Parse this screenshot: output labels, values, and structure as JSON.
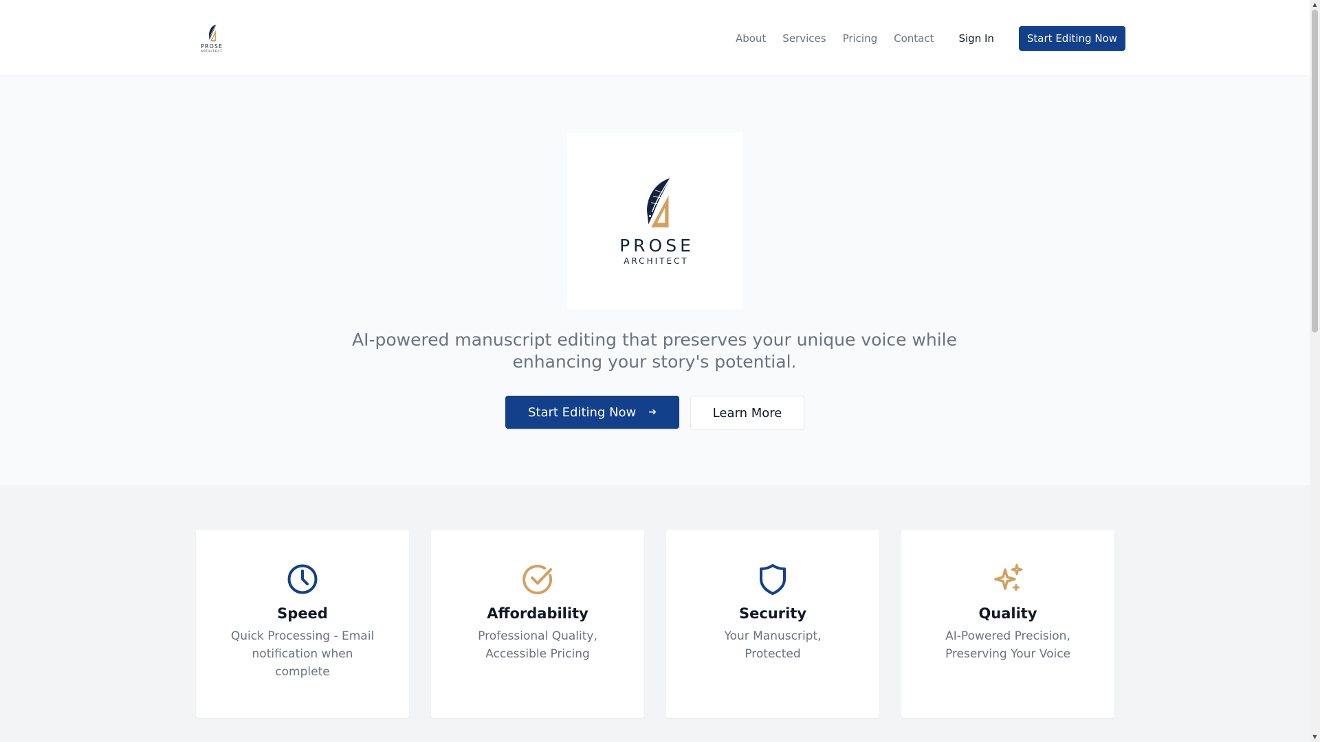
{
  "header": {
    "logo": {
      "wordmark": "PROSE",
      "subtitle": "ARCHITECT"
    },
    "nav": [
      {
        "label": "About"
      },
      {
        "label": "Services"
      },
      {
        "label": "Pricing"
      },
      {
        "label": "Contact"
      }
    ],
    "sign_in_label": "Sign In",
    "cta_label": "Start Editing Now"
  },
  "hero": {
    "logo": {
      "wordmark": "PROSE",
      "subtitle": "ARCHITECT"
    },
    "tagline": "AI-powered manuscript editing that preserves your unique voice while enhancing your story's potential.",
    "primary_button": {
      "label": "Start Editing Now",
      "icon": "arrow-right-icon"
    },
    "secondary_button": {
      "label": "Learn More"
    }
  },
  "features": [
    {
      "icon": "clock-icon",
      "title": "Speed",
      "description": "Quick Processing - Email notification when complete",
      "color": "#12408a"
    },
    {
      "icon": "check-circle-icon",
      "title": "Affordability",
      "description": "Professional Quality, Accessible Pricing",
      "color": "#d4a060"
    },
    {
      "icon": "shield-icon",
      "title": "Security",
      "description": "Your Manuscript, Protected",
      "color": "#12408a"
    },
    {
      "icon": "sparkles-icon",
      "title": "Quality",
      "description": "AI-Powered Precision, Preserving Your Voice",
      "color": "#d4a060"
    }
  ],
  "colors": {
    "primary": "#12408a",
    "accent": "#d4a060",
    "brand_dark": "#13233f",
    "muted_text": "#6b7280"
  }
}
